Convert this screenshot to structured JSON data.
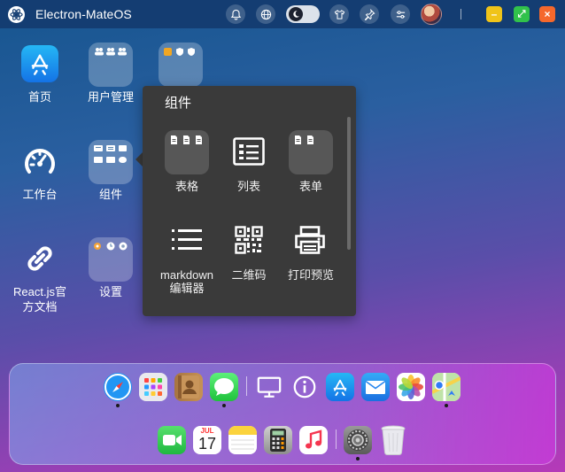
{
  "titlebar": {
    "app_title": "Electron-MateOS",
    "icons": [
      "bell-icon",
      "globe-icon",
      "moon-icon",
      "tshirt-icon",
      "pin-icon",
      "sliders-icon"
    ],
    "window_controls": {
      "minimize": "–",
      "maximize": "⤢",
      "close": "×"
    },
    "colors": {
      "bar": "#143d72",
      "minimize": "#f0c419",
      "maximize": "#31c24b",
      "close": "#f5682c"
    }
  },
  "desktop": {
    "items": [
      {
        "label": "首页",
        "icon": "app-store-icon"
      },
      {
        "label": "用户管理",
        "icon": "folder-icon"
      },
      {
        "label": "",
        "icon": "folder-icon"
      },
      {
        "label": "工作台",
        "icon": "dashboard-gauge-icon"
      },
      {
        "label": "组件",
        "icon": "folder-icon"
      },
      {
        "label": "React.js官\n方文档",
        "icon": "link-icon"
      },
      {
        "label": "设置",
        "icon": "folder-icon"
      }
    ]
  },
  "popup": {
    "title": "组件",
    "items": [
      {
        "label": "表格",
        "icon": "folder-icon"
      },
      {
        "label": "列表",
        "icon": "list-card-icon"
      },
      {
        "label": "表单",
        "icon": "folder-icon"
      },
      {
        "label": "markdown\n编辑器",
        "icon": "list-lines-icon"
      },
      {
        "label": "二维码",
        "icon": "qrcode-icon"
      },
      {
        "label": "打印预览",
        "icon": "printer-icon"
      }
    ]
  },
  "dock": {
    "row1": [
      "safari-icon",
      "launchpad-icon",
      "contacts-icon",
      "messages-icon",
      "monitor-icon",
      "info-icon",
      "app-store-icon",
      "mail-icon",
      "photos-icon",
      "maps-icon"
    ],
    "row2": [
      "facetime-icon",
      "calendar-icon",
      "notes-icon",
      "calculator-icon",
      "music-icon",
      "settings-icon",
      "trash-icon"
    ],
    "calendar": {
      "month": "JUL",
      "day": "17"
    }
  }
}
